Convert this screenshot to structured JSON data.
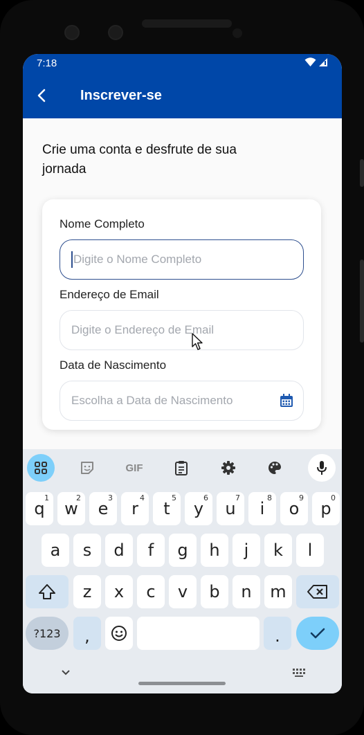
{
  "status": {
    "time": "7:18"
  },
  "appbar": {
    "title": "Inscrever-se"
  },
  "headline": "Crie uma conta e desfrute de sua jornada",
  "form": {
    "name_label": "Nome Completo",
    "name_placeholder": "Digite o Nome Completo",
    "email_label": "Endereço de Email",
    "email_placeholder": "Digite o Endereço de Email",
    "dob_label": "Data de Nascimento",
    "dob_placeholder": "Escolha a Data de Nascimento"
  },
  "keyboard": {
    "toolbar": {
      "gif": "GIF"
    },
    "row1": [
      {
        "k": "q",
        "n": "1"
      },
      {
        "k": "w",
        "n": "2"
      },
      {
        "k": "e",
        "n": "3"
      },
      {
        "k": "r",
        "n": "4"
      },
      {
        "k": "t",
        "n": "5"
      },
      {
        "k": "y",
        "n": "6"
      },
      {
        "k": "u",
        "n": "7"
      },
      {
        "k": "i",
        "n": "8"
      },
      {
        "k": "o",
        "n": "9"
      },
      {
        "k": "p",
        "n": "0"
      }
    ],
    "row2": [
      "a",
      "s",
      "d",
      "f",
      "g",
      "h",
      "j",
      "k",
      "l"
    ],
    "row3": [
      "z",
      "x",
      "c",
      "v",
      "b",
      "n",
      "m"
    ],
    "sym_label": "?123",
    "comma": ",",
    "period": "."
  },
  "colors": {
    "primary": "#0047a8",
    "accent": "#7dcffa",
    "keyboard_bg": "#e7ebf0"
  }
}
